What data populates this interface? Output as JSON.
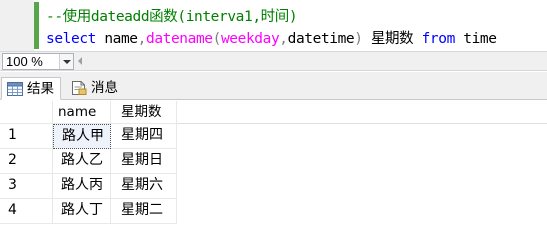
{
  "editor": {
    "line1": "--使用dateadd函数(interva1,时间)",
    "line2_parts": {
      "select": "select",
      "name": " name",
      "comma1": ",",
      "datename": "datename",
      "open": "(",
      "weekday": "weekday",
      "comma2": ",",
      "datetime": "datetime",
      "close": ")",
      "alias": " 星期数 ",
      "from": "from",
      "table": " time"
    }
  },
  "zoom": {
    "value": "100 %"
  },
  "tabs": [
    {
      "label": "结果",
      "icon": "results-grid-icon"
    },
    {
      "label": "消息",
      "icon": "messages-icon"
    }
  ],
  "grid": {
    "columns": [
      "name",
      "星期数"
    ],
    "rows": [
      {
        "num": "1",
        "name": "路人甲",
        "weekday": "星期四"
      },
      {
        "num": "2",
        "name": "路人乙",
        "weekday": "星期日"
      },
      {
        "num": "3",
        "name": "路人丙",
        "weekday": "星期六"
      },
      {
        "num": "4",
        "name": "路人丁",
        "weekday": "星期二"
      }
    ]
  },
  "colors": {
    "comment": "#008000",
    "keyword": "#0000ff",
    "function": "#ff00ff",
    "operator": "#808080",
    "change_bar": "#57a64a"
  }
}
